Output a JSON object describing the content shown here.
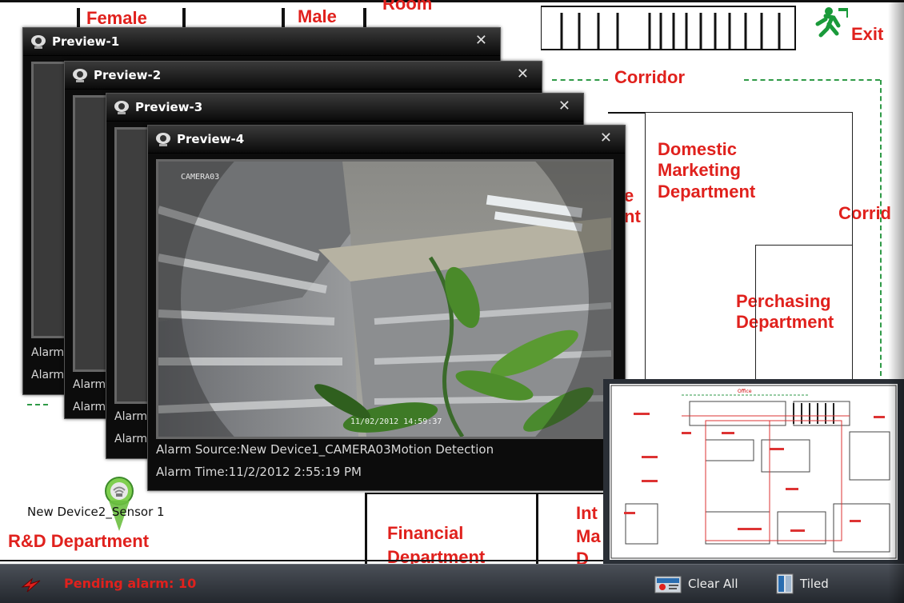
{
  "map": {
    "labels": {
      "female": "Female",
      "male": "Male",
      "room": "Room",
      "exit": "Exit",
      "corridor_top": "Corridor",
      "corridor_right": "Corrid",
      "domestic": "Domestic\nMarketing\nDepartment",
      "purchasing": "Perchasing\nDepartment",
      "rnd": "R&D Department",
      "financial": "Financial\nDepartment",
      "int_partial": "Int\nMa\nD",
      "e_partial": "e\nnt"
    },
    "device_label": "New Device2_Sensor 1"
  },
  "previews": [
    {
      "title": "Preview-1",
      "alarm_source": "Alarm",
      "alarm_time": "Alarm"
    },
    {
      "title": "Preview-2",
      "alarm_source": "Alarm",
      "alarm_time": "Alarm"
    },
    {
      "title": "Preview-3",
      "alarm_source": "Alarm",
      "alarm_time": "Alarm"
    },
    {
      "title": "Preview-4",
      "alarm_source": "Alarm Source:New Device1_CAMERA03Motion Detection",
      "alarm_time": "Alarm Time:11/2/2012 2:55:19 PM",
      "camera_name": "CAMERA03",
      "timestamp": "11/02/2012 14:59:37"
    }
  ],
  "close_glyph": "✕",
  "minimap": {
    "label": "Office"
  },
  "bottom_bar": {
    "pending_text": "Pending alarm: 10",
    "clear_all": "Clear All",
    "tiled": "Tiled"
  },
  "colors": {
    "label_red": "#e0211d",
    "corridor_green": "#2f9a47",
    "bar_dark": "#23272d"
  }
}
